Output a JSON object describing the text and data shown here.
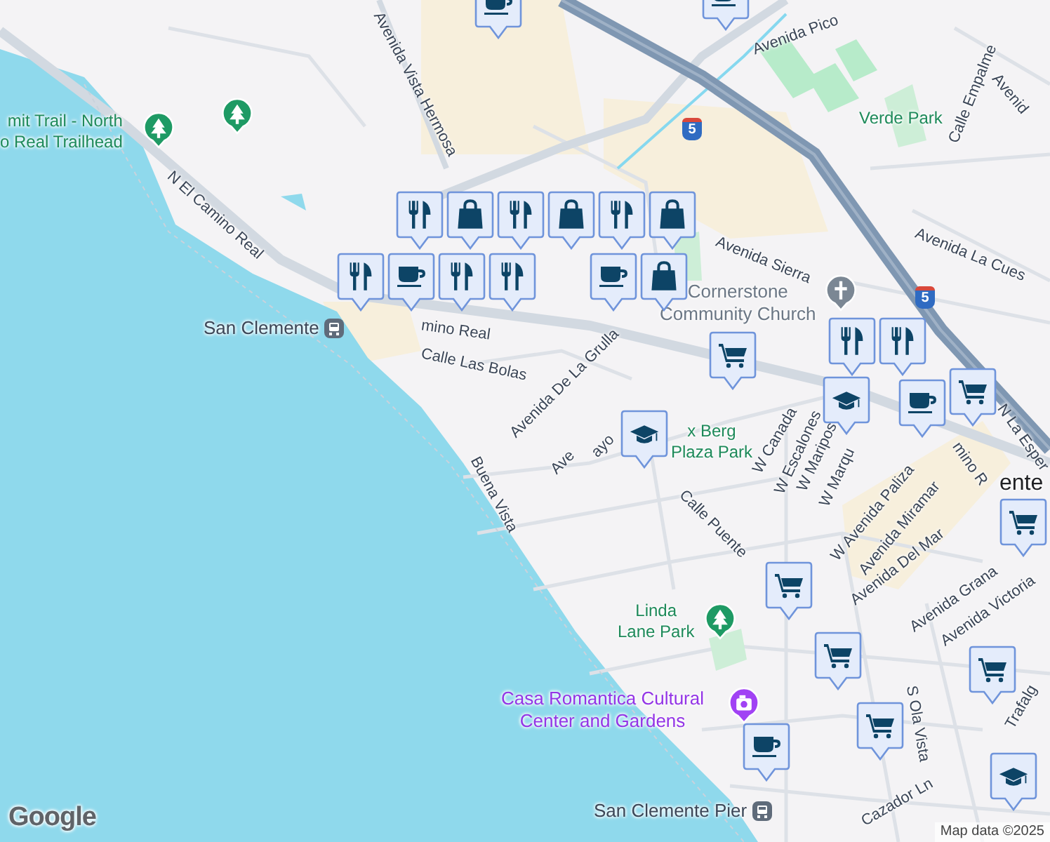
{
  "map": {
    "labels": [
      {
        "text": "Avenida Vista Hermosa",
        "kind": "street"
      },
      {
        "text": "Avenida Pico",
        "kind": "street"
      },
      {
        "text": "mit Trail - North\no Real Trailhead",
        "kind": "park"
      },
      {
        "text": "N El Camino Real",
        "kind": "street"
      },
      {
        "text": "mino Real",
        "kind": "street"
      },
      {
        "text": "San Clemente",
        "kind": "transit"
      },
      {
        "text": "Calle Las Bolas",
        "kind": "street"
      },
      {
        "text": "Avenida Sierra",
        "kind": "street"
      },
      {
        "text": "Verde Park",
        "kind": "park"
      },
      {
        "text": "Calle Empalme",
        "kind": "street"
      },
      {
        "text": "Avenida La Cues",
        "kind": "street"
      },
      {
        "text": "Avenid",
        "kind": "street"
      },
      {
        "text": "Cornerstone\nCommunity Church",
        "kind": "church"
      },
      {
        "text": "Avenida De La Grulla",
        "kind": "street"
      },
      {
        "text": "Ave",
        "kind": "street"
      },
      {
        "text": "ayo",
        "kind": "street"
      },
      {
        "text": "x Berg\nPlaza Park",
        "kind": "park"
      },
      {
        "text": "Calle Puente",
        "kind": "street"
      },
      {
        "text": "W Canada",
        "kind": "street"
      },
      {
        "text": "W Escalones",
        "kind": "street"
      },
      {
        "text": "W Maripos",
        "kind": "street"
      },
      {
        "text": "W Marqu",
        "kind": "street"
      },
      {
        "text": "W Avenida Paliza",
        "kind": "street"
      },
      {
        "text": "Avenida Miramar",
        "kind": "street"
      },
      {
        "text": "Avenida Del Mar",
        "kind": "street"
      },
      {
        "text": "Avenida Grana",
        "kind": "street"
      },
      {
        "text": "Avenida Victoria",
        "kind": "street"
      },
      {
        "text": "Buena Vista",
        "kind": "street"
      },
      {
        "text": "Linda\nLane Park",
        "kind": "park"
      },
      {
        "text": "Casa Romantica Cultural\nCenter and Gardens",
        "kind": "attraction"
      },
      {
        "text": "San Clemente Pier",
        "kind": "transit"
      },
      {
        "text": "S Ola Vista",
        "kind": "street"
      },
      {
        "text": "Cazador Ln",
        "kind": "street"
      },
      {
        "text": "Trafalg",
        "kind": "street"
      },
      {
        "text": "N La Esper",
        "kind": "street"
      },
      {
        "text": "mino R",
        "kind": "street"
      },
      {
        "text": "ente",
        "kind": "city"
      }
    ],
    "pins": [
      {
        "kind": "park"
      },
      {
        "kind": "park"
      },
      {
        "kind": "park"
      },
      {
        "kind": "church"
      },
      {
        "kind": "museum"
      }
    ],
    "highway_shields": [
      {
        "text": "5"
      },
      {
        "text": "5"
      }
    ],
    "markers": [
      {
        "kind": "cafe"
      },
      {
        "kind": "cafe"
      },
      {
        "kind": "restaurant"
      },
      {
        "kind": "shopping"
      },
      {
        "kind": "restaurant"
      },
      {
        "kind": "shopping"
      },
      {
        "kind": "restaurant"
      },
      {
        "kind": "shopping"
      },
      {
        "kind": "restaurant"
      },
      {
        "kind": "cafe"
      },
      {
        "kind": "restaurant"
      },
      {
        "kind": "restaurant"
      },
      {
        "kind": "cafe"
      },
      {
        "kind": "shopping"
      },
      {
        "kind": "grocery"
      },
      {
        "kind": "restaurant"
      },
      {
        "kind": "restaurant"
      },
      {
        "kind": "grocery"
      },
      {
        "kind": "school"
      },
      {
        "kind": "cafe"
      },
      {
        "kind": "grocery"
      },
      {
        "kind": "school"
      },
      {
        "kind": "grocery"
      },
      {
        "kind": "grocery"
      },
      {
        "kind": "grocery"
      },
      {
        "kind": "grocery"
      },
      {
        "kind": "cafe"
      },
      {
        "kind": "school"
      }
    ],
    "attribution": "Map data ©2025",
    "logo": "Google"
  }
}
